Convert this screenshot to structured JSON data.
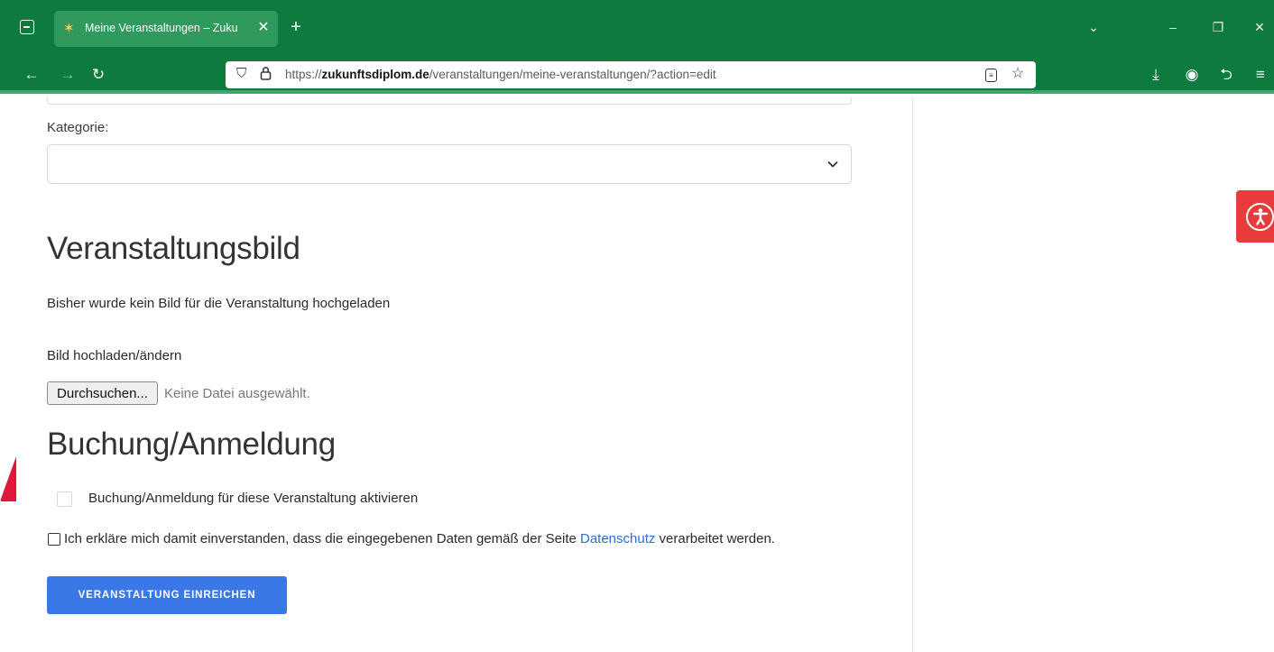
{
  "browser": {
    "tab_title": "Meine Veranstaltungen – Zuku",
    "tab_close": "✕",
    "new_tab": "+",
    "url_host": "zukunftsdiplom.de",
    "url_prefix": "https://",
    "url_path": "/veranstaltungen/meine-veranstaltungen/?action=edit",
    "icons": {
      "tab_list": "tab-list-icon",
      "back": "←",
      "forward": "→",
      "reload": "↻",
      "star": "☆",
      "download": "⤓",
      "account": "◉",
      "extensions": "⮌",
      "menu": "≡",
      "chevron": "⌄",
      "minimize": "–",
      "restore": "❐",
      "close": "✕"
    },
    "colors": {
      "chrome": "#0d7a3e",
      "tab_active": "#2f9a5b"
    }
  },
  "form": {
    "kategorie_label": "Kategorie:",
    "kategorie_value": "",
    "bild_heading": "Veranstaltungsbild",
    "bild_status": "Bisher wurde kein Bild für die Veranstaltung hochgeladen",
    "upload_label": "Bild hochladen/ändern",
    "file_button": "Durchsuchen...",
    "file_status": "Keine Datei ausgewählt.",
    "buchung_heading": "Buchung/Anmeldung",
    "booking_checkbox_label": "Buchung/Anmeldung für diese Veranstaltung aktivieren",
    "privacy_prefix": "Ich erkläre mich damit einverstanden, dass die eingegebenen Daten gemäß der Seite ",
    "privacy_link": "Datenschutz",
    "privacy_suffix": " verarbeitet werden.",
    "submit_label": "VERANSTALTUNG EINREICHEN",
    "colors": {
      "submit": "#3a78e8",
      "link": "#2a6fd6",
      "accessibility": "#e63c3c"
    }
  },
  "accessibility": {
    "icon": "accessibility-icon"
  }
}
